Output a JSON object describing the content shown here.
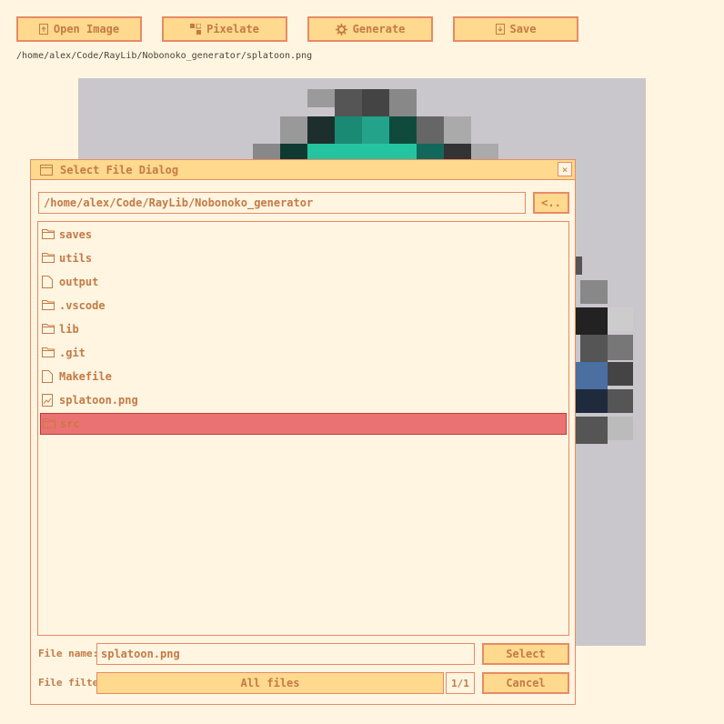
{
  "toolbar": {
    "open_label": "Open Image",
    "pixelate_label": "Pixelate",
    "generate_label": "Generate",
    "save_label": "Save"
  },
  "current_file_path": "/home/alex/Code/RayLib/Nobonoko_generator/splatoon.png",
  "dialog": {
    "title": "Select File Dialog",
    "close_label": "×",
    "directory": "/home/alex/Code/RayLib/Nobonoko_generator",
    "back_label": "<..",
    "entries": [
      {
        "name": "saves",
        "kind": "folder"
      },
      {
        "name": "utils",
        "kind": "folder"
      },
      {
        "name": "output",
        "kind": "file"
      },
      {
        "name": ".vscode",
        "kind": "folder"
      },
      {
        "name": "lib",
        "kind": "folder"
      },
      {
        "name": ".git",
        "kind": "folder"
      },
      {
        "name": "Makefile",
        "kind": "file"
      },
      {
        "name": "splatoon.png",
        "kind": "image"
      },
      {
        "name": "src",
        "kind": "folder",
        "selected": true
      }
    ],
    "file_name_label": "File name:",
    "file_name_value": "splatoon.png",
    "file_filter_label": "File filter:",
    "file_filter_value": "All files",
    "filter_page": "1/1",
    "select_label": "Select",
    "cancel_label": "Cancel"
  },
  "colors": {
    "background": "#fff5e1",
    "button_fill": "#ffd98d",
    "border": "#e78a66",
    "text": "#c57a45",
    "selected_row": "#eb7272",
    "canvas": "#c9c7cc"
  }
}
